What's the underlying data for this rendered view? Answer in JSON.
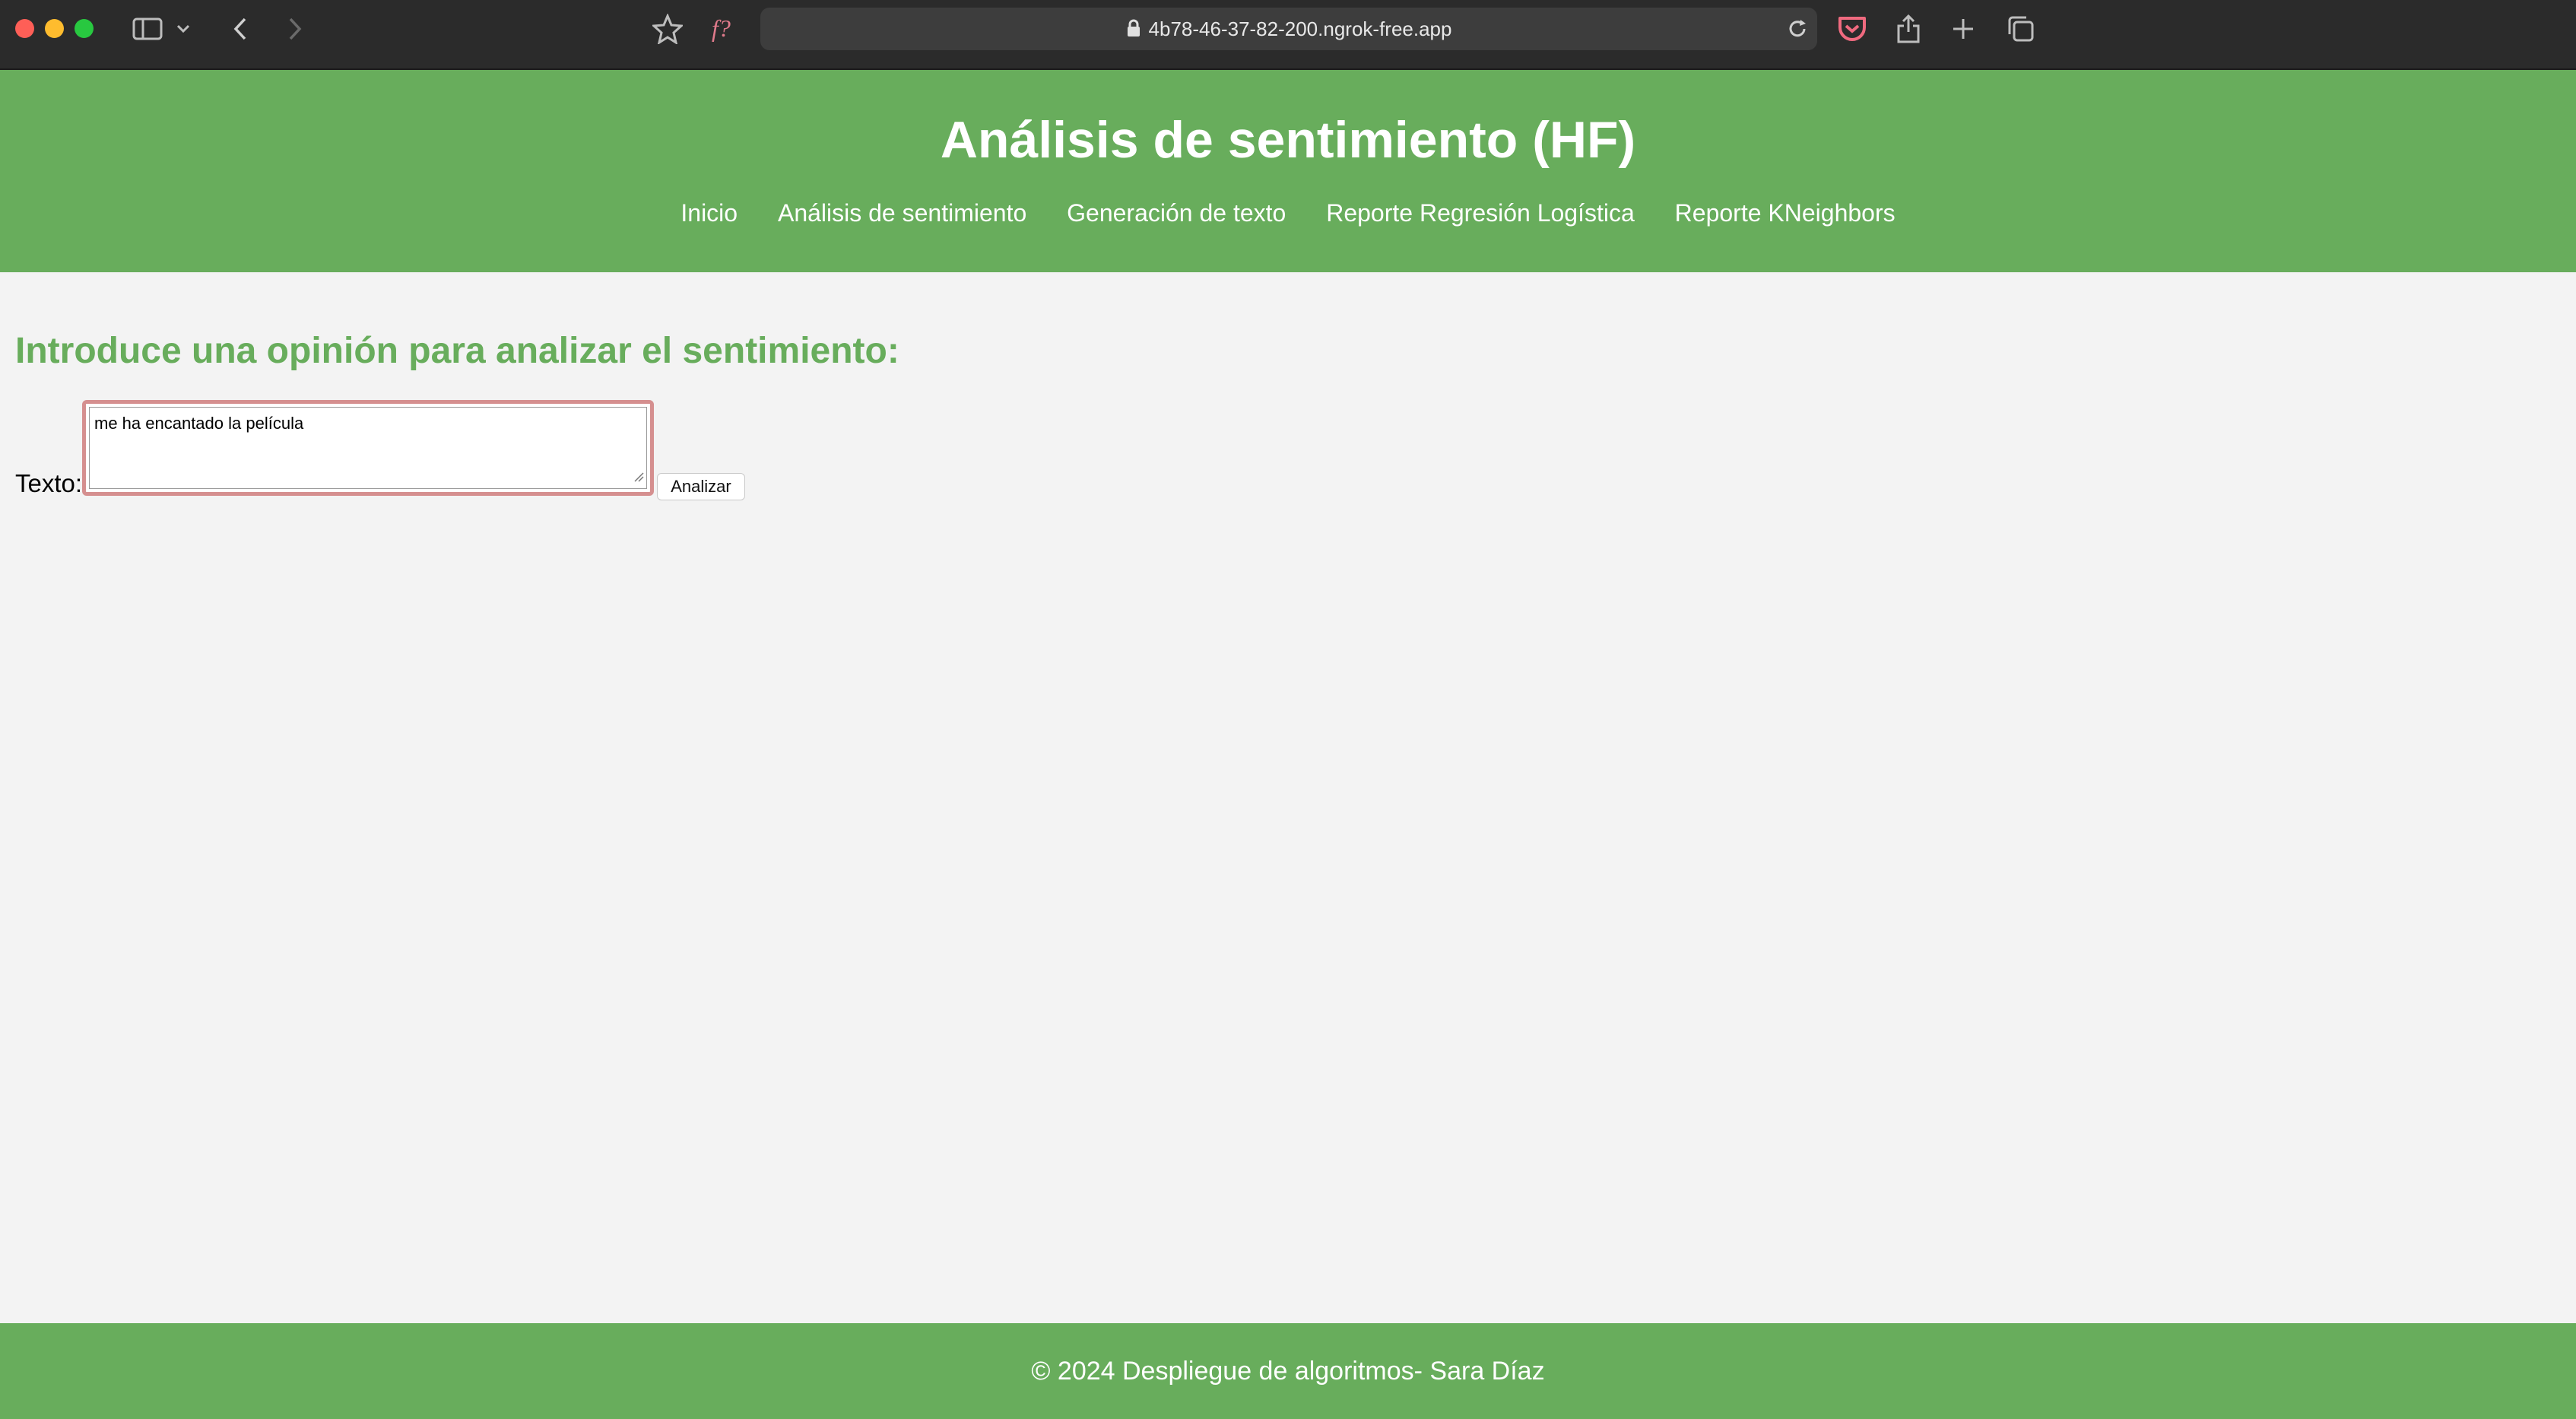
{
  "browser": {
    "url": "4b78-46-37-82-200.ngrok-free.app",
    "icons": [
      "sidebar-icon",
      "chevron-down-icon",
      "back-icon",
      "forward-icon",
      "star-icon",
      "f-icon",
      "lock-icon",
      "reload-icon",
      "pocket-icon",
      "share-icon",
      "plus-icon",
      "tabs-icon"
    ]
  },
  "header": {
    "title": "Análisis de sentimiento (HF)",
    "nav": [
      {
        "label": "Inicio"
      },
      {
        "label": "Análisis de sentimiento"
      },
      {
        "label": "Generación de texto"
      },
      {
        "label": "Reporte Regresión Logística"
      },
      {
        "label": "Reporte KNeighbors"
      }
    ]
  },
  "main": {
    "heading": "Introduce una opinión para analizar el sentimiento:",
    "form": {
      "label": "Texto:",
      "value": "me ha encantado la película",
      "button_label": "Analizar"
    }
  },
  "footer": {
    "text": "© 2024 Despliegue de algoritmos- Sara Díaz"
  },
  "colors": {
    "brand_green": "#68ad5c",
    "background": "#f3f3f3",
    "textarea_focus_border": "#d58f8f"
  }
}
